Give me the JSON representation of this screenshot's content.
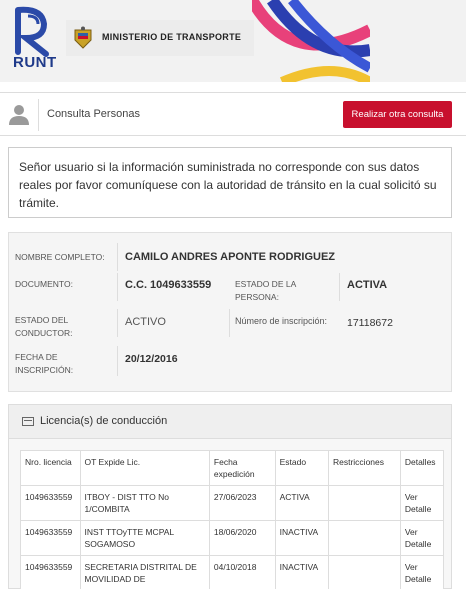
{
  "header": {
    "brand": "RUNT",
    "ministry": "MINISTERIO DE TRANSPORTE"
  },
  "topbar": {
    "title": "Consulta Personas",
    "button_label": "Realizar otra consulta"
  },
  "notice": {
    "text": "Señor usuario si la información suministrada no corresponde con sus datos reales por favor comuníquese con la autoridad de tránsito en la cual solicitó su trámite."
  },
  "person": {
    "full_name_label": "NOMBRE COMPLETO:",
    "full_name": "CAMILO ANDRES APONTE RODRIGUEZ",
    "document_label": "DOCUMENTO:",
    "document": "C.C. 1049633559",
    "person_state_label_1": "ESTADO DE LA",
    "person_state_label_2": "PERSONA:",
    "person_state": "ACTIVA",
    "driver_state_label_1": "ESTADO DEL",
    "driver_state_label_2": "CONDUCTOR:",
    "driver_state": "ACTIVO",
    "inscription_number_label": "Número de inscripción:",
    "inscription_number": "17118672",
    "inscription_date_label_1": "FECHA DE",
    "inscription_date_label_2": "INSCRIPCIÓN:",
    "inscription_date": "20/12/2016"
  },
  "licenses": {
    "title": "Licencia(s) de conducción",
    "columns": [
      "Nro. licencia",
      "OT Expide Lic.",
      "Fecha expedición",
      "Estado",
      "Restricciones",
      "Detalles"
    ],
    "rows": [
      {
        "number": "1049633559",
        "ot": "ITBOY - DIST TTO No 1/COMBITA",
        "date": "27/06/2023",
        "state": "ACTIVA",
        "restrictions": "",
        "details": "Ver Detalle"
      },
      {
        "number": "1049633559",
        "ot": "INST TTOyTTE MCPAL SOGAMOSO",
        "date": "18/06/2020",
        "state": "INACTIVA",
        "restrictions": "",
        "details": "Ver Detalle"
      },
      {
        "number": "1049633559",
        "ot": "SECRETARIA DISTRITAL DE MOVILIDAD DE",
        "date": "04/10/2018",
        "state": "INACTIVA",
        "restrictions": "",
        "details": "Ver Detalle"
      }
    ]
  },
  "colors": {
    "accent_red": "#c8102e",
    "runt_blue": "#1f3a8a"
  }
}
